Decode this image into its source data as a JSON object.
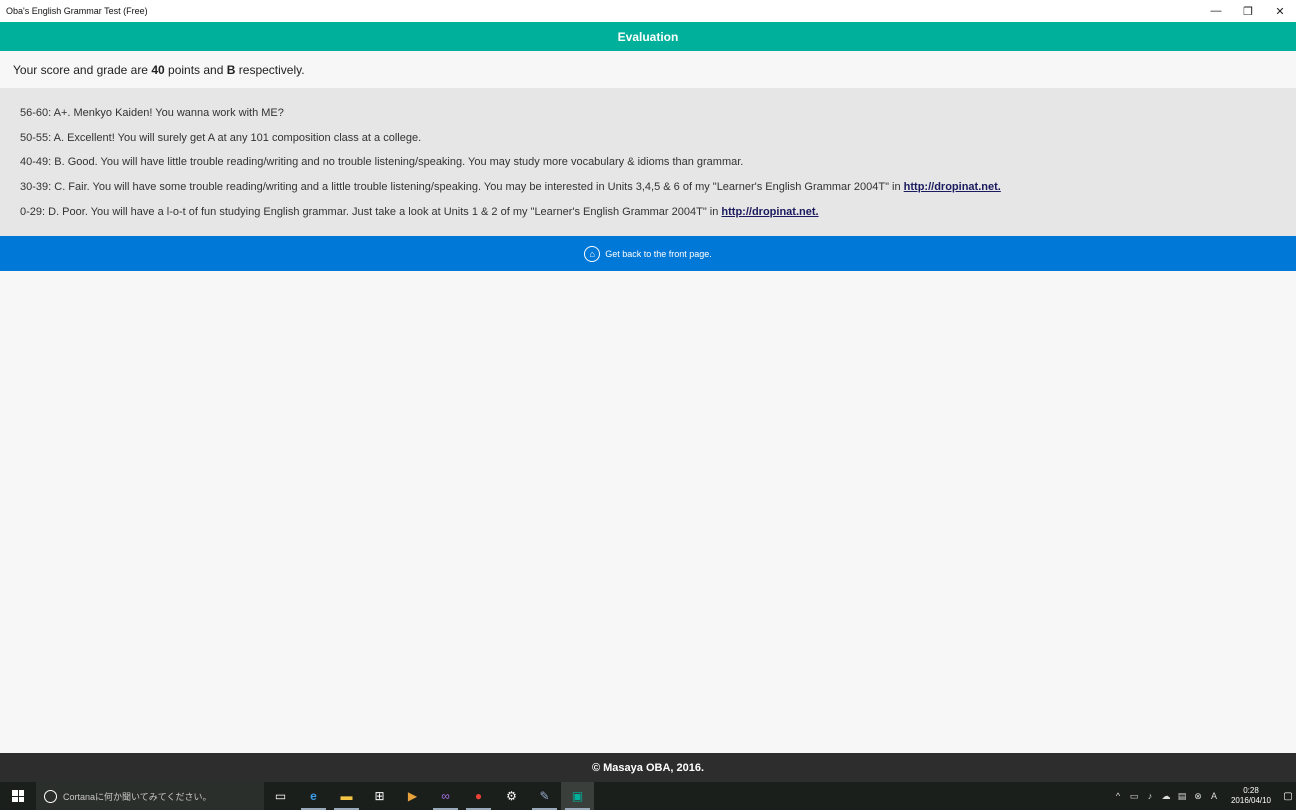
{
  "window": {
    "title": "Oba's English Grammar Test (Free)",
    "minimize": "—",
    "restore": "❐",
    "close": "✕"
  },
  "header": {
    "title": "Evaluation"
  },
  "score": {
    "prefix": "Your score and grade are ",
    "points": "40",
    "middle": " points and ",
    "grade": "B",
    "suffix": " respectively."
  },
  "grades": [
    {
      "text": "56-60: A+. Menkyo Kaiden! You wanna work with ME?",
      "link": ""
    },
    {
      "text": "50-55: A. Excellent! You will surely get A at any 101 composition class at a college.",
      "link": ""
    },
    {
      "text": "40-49: B. Good. You will have little trouble reading/writing and no trouble listening/speaking. You may study more vocabulary & idioms than grammar.",
      "link": ""
    },
    {
      "text": "30-39: C. Fair. You will have some trouble reading/writing and a little trouble listening/speaking. You may be interested in Units 3,4,5 & 6 of my \"Learner's English Grammar 2004T\" in ",
      "link": "http://dropinat.net."
    },
    {
      "text": "0-29: D. Poor. You will have a l-o-t of fun studying English grammar. Just take a look at Units 1 & 2 of my \"Learner's English Grammar 2004T\" in ",
      "link": "http://dropinat.net."
    }
  ],
  "back": {
    "label": "Get back to the front page."
  },
  "footer": {
    "text": "© Masaya OBA, 2016."
  },
  "taskbar": {
    "cortana_placeholder": "Cortanaに何か聞いてみてください。",
    "time": "0:28",
    "date": "2016/04/10"
  },
  "colors": {
    "header": "#00b09b",
    "backbar": "#0078d7",
    "footer": "#2d2d2d"
  }
}
